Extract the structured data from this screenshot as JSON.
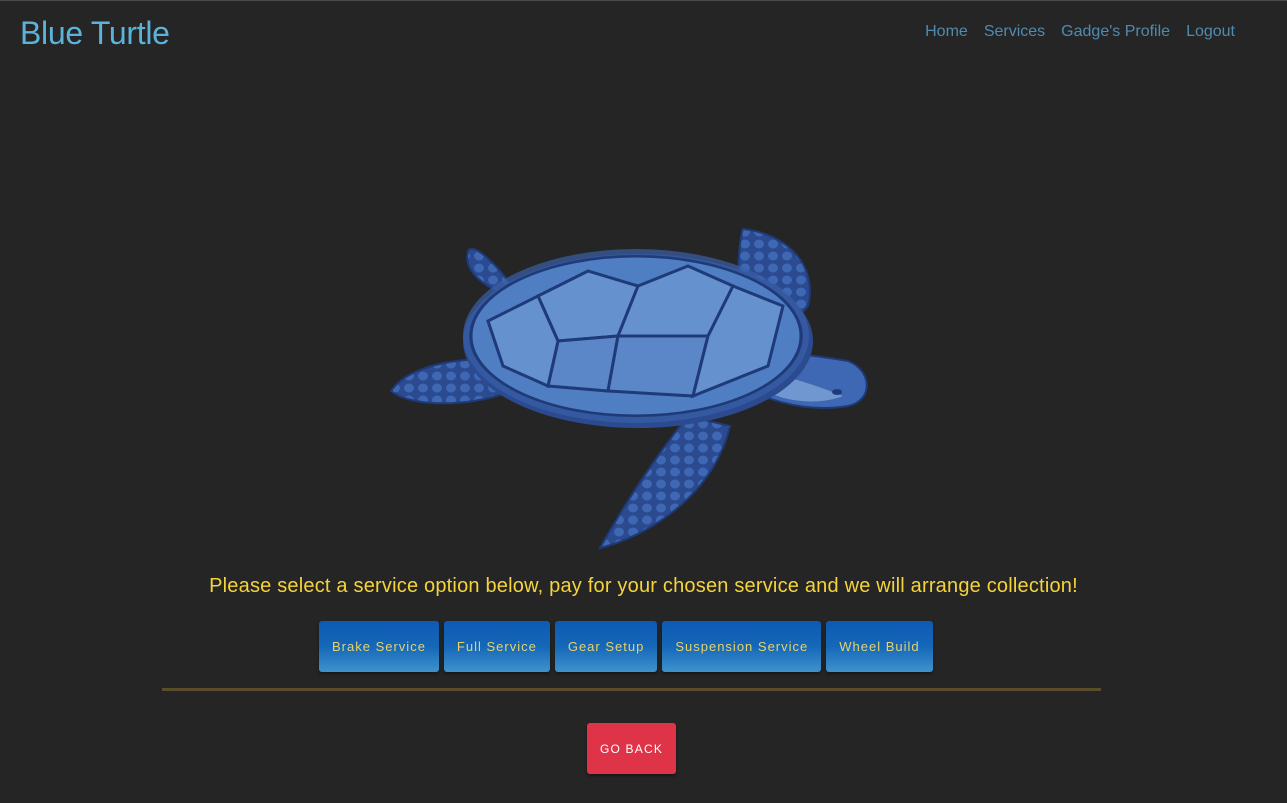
{
  "header": {
    "brand": "Blue Turtle",
    "nav": [
      {
        "label": "Home"
      },
      {
        "label": "Services"
      },
      {
        "label": "Gadge's Profile"
      },
      {
        "label": "Logout"
      }
    ]
  },
  "hero": {
    "image": "sea-turtle-illustration"
  },
  "main": {
    "intro": "Please select a service option below, pay for your chosen service and we will arrange collection!",
    "services": [
      {
        "label": "Brake Service"
      },
      {
        "label": "Full Service"
      },
      {
        "label": "Gear Setup"
      },
      {
        "label": "Suspension Service"
      },
      {
        "label": "Wheel Build"
      }
    ],
    "back_label": "GO BACK"
  },
  "colors": {
    "background": "#252525",
    "brand": "#5cb3d9",
    "nav_link": "#4f8bb0",
    "intro_text": "#f4d43a",
    "service_button": "#1567b8",
    "divider": "#5b4d2c",
    "back_button": "#df3448"
  }
}
